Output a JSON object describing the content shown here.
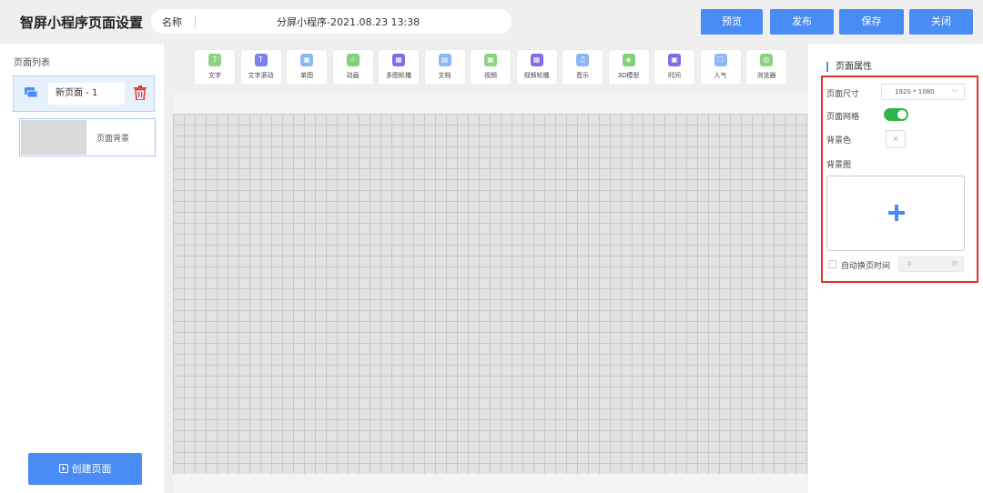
{
  "header": {
    "title": "智屏小程序页面设置",
    "name_label": "名称",
    "name_value": "分屏小程序-2021.08.23 13:38",
    "buttons": {
      "preview": "预览",
      "publish": "发布",
      "save": "保存",
      "close": "关闭"
    }
  },
  "left_panel": {
    "title": "页面列表",
    "page_item": {
      "name": "新页面 - 1"
    },
    "bg_item": {
      "label": "页面背景"
    },
    "create_button": "创建页面"
  },
  "toolbar": {
    "tools": [
      {
        "label": "文字",
        "icon": "text-icon",
        "color": "#8bd37e"
      },
      {
        "label": "文字滚动",
        "icon": "text-scroll-icon",
        "color": "#7b7ff0"
      },
      {
        "label": "单图",
        "icon": "image-icon",
        "color": "#8cb6f5"
      },
      {
        "label": "动画",
        "icon": "animation-icon",
        "color": "#80d27a"
      },
      {
        "label": "多图轮播",
        "icon": "carousel-icon",
        "color": "#7b6ee8"
      },
      {
        "label": "文档",
        "icon": "document-icon",
        "color": "#8cb6f5"
      },
      {
        "label": "视频",
        "icon": "video-icon",
        "color": "#8bd37e"
      },
      {
        "label": "视频轮播",
        "icon": "video-carousel-icon",
        "color": "#7b6ee8"
      },
      {
        "label": "音乐",
        "icon": "music-icon",
        "color": "#8cb6f5"
      },
      {
        "label": "3D模型",
        "icon": "3d-model-icon",
        "color": "#80d27a"
      },
      {
        "label": "时间",
        "icon": "clock-icon",
        "color": "#7b6ee8"
      },
      {
        "label": "人气",
        "icon": "popularity-icon",
        "color": "#8cb6f5"
      },
      {
        "label": "浏览器",
        "icon": "browser-icon",
        "color": "#8bd37e"
      }
    ]
  },
  "right_panel": {
    "title": "页面属性",
    "page_size_label": "页面尺寸",
    "page_size_value": "1920 * 1080",
    "page_grid_label": "页面网格",
    "page_grid_on": true,
    "bg_color_label": "背景色",
    "bg_color_value": "×",
    "bg_image_label": "背景图",
    "auto_switch_label": "自动换页时间",
    "auto_switch_value": "0",
    "auto_switch_unit": "秒"
  },
  "colors": {
    "accent": "#4a8cf5",
    "toggle_on": "#2fb44a",
    "highlight": "#e4322b",
    "trash": "#e4322b"
  }
}
